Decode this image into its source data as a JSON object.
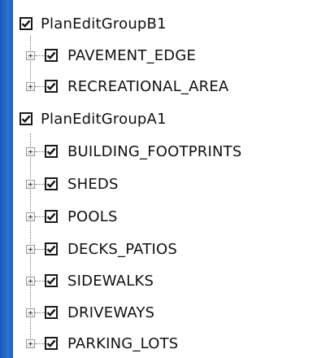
{
  "layer_tree": {
    "groups": [
      {
        "name": "PlanEditGroupB1",
        "checked": true,
        "layers": [
          {
            "name": "PAVEMENT_EDGE",
            "checked": true
          },
          {
            "name": "RECREATIONAL_AREA",
            "checked": true
          }
        ]
      },
      {
        "name": "PlanEditGroupA1",
        "checked": true,
        "layers": [
          {
            "name": "BUILDING_FOOTPRINTS",
            "checked": true
          },
          {
            "name": "SHEDS",
            "checked": true
          },
          {
            "name": "POOLS",
            "checked": true
          },
          {
            "name": "DECKS_PATIOS",
            "checked": true
          },
          {
            "name": "SIDEWALKS",
            "checked": true
          },
          {
            "name": "DRIVEWAYS",
            "checked": true
          },
          {
            "name": "PARKING_LOTS",
            "checked": true
          }
        ]
      }
    ]
  }
}
